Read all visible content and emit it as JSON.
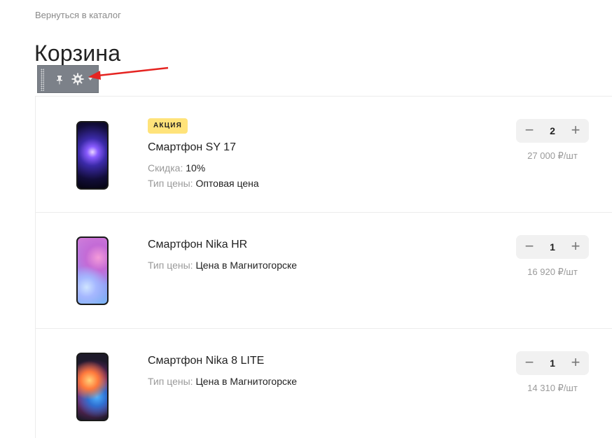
{
  "nav": {
    "back_label": "Вернуться в каталог"
  },
  "page": {
    "title": "Корзина"
  },
  "admin_toolbar": {
    "pin_icon": "pin-icon",
    "gear_icon": "gear-icon",
    "caret_icon": "chevron-down-icon"
  },
  "colors": {
    "badge_bg": "#ffe37a",
    "annotation_arrow": "#e52421"
  },
  "cart": {
    "items": [
      {
        "badge": "АКЦИЯ",
        "name": "Смартфон SY 17",
        "props": [
          {
            "label": "Скидка:",
            "value": "10%"
          },
          {
            "label": "Тип цены:",
            "value": "Оптовая цена"
          }
        ],
        "quantity": "2",
        "unit_price": "27 000 ₽/шт"
      },
      {
        "name": "Смартфон Nika HR",
        "props": [
          {
            "label": "Тип цены:",
            "value": "Цена в Магнитогорске"
          }
        ],
        "quantity": "1",
        "unit_price": "16 920 ₽/шт"
      },
      {
        "name": "Смартфон Nika 8 LITE",
        "props": [
          {
            "label": "Тип цены:",
            "value": "Цена в Магнитогорске"
          }
        ],
        "quantity": "1",
        "unit_price": "14 310 ₽/шт"
      }
    ],
    "minus_label": "−",
    "plus_label": "+"
  }
}
